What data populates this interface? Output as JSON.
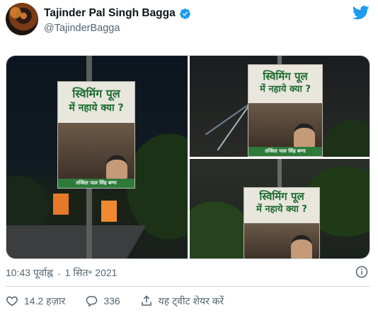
{
  "author": {
    "display_name": "Tajinder Pal Singh Bagga",
    "handle": "@TajinderBagga",
    "verified": true
  },
  "media": {
    "poster_line1": "स्विमिंग पूल",
    "poster_line2": "में नहाये क्या ?",
    "poster_footer": "तजिंदर पाल सिंह बग्गा"
  },
  "timestamp": {
    "time": "10:43 पूर्वाह्न",
    "separator": "·",
    "date": "1 सित॰ 2021"
  },
  "actions": {
    "likes": "14.2 हज़ार",
    "replies": "336",
    "share_label": "यह ट्वीट शेयर करें"
  },
  "colors": {
    "brand": "#1d9bf0",
    "text_secondary": "#536471",
    "poster_green": "#1b6b2e"
  }
}
